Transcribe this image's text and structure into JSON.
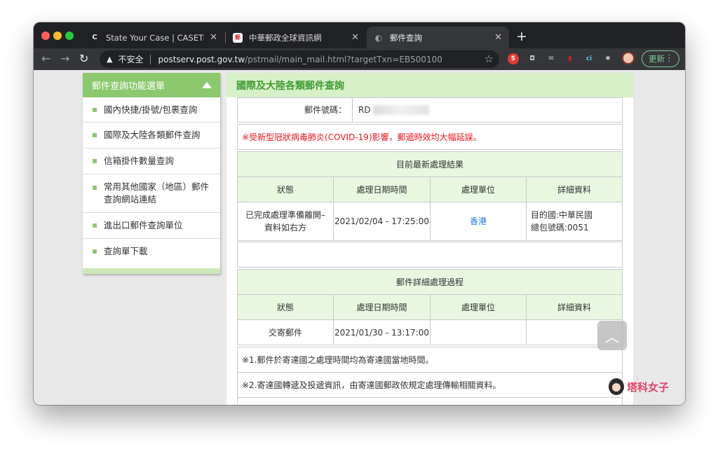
{
  "browser": {
    "tabs": [
      {
        "title": "State Your Case | CASETiFY",
        "favicon": "C",
        "close": "✕"
      },
      {
        "title": "中華郵政全球資訊網",
        "favicon": "郵",
        "close": "✕"
      },
      {
        "title": "郵件查詢",
        "favicon": "◐",
        "close": "✕"
      }
    ],
    "new_tab": "+",
    "nav": {
      "back": "←",
      "forward": "→",
      "reload": "↻"
    },
    "address": {
      "warning_icon": "▲",
      "insecure_label": "不安全",
      "host": "postserv.post.gov.tw",
      "path": "/pstmail/main_mail.html?targetTxn=EB500100",
      "star": "☆"
    },
    "extensions": [
      {
        "name": "s-extension-icon",
        "glyph": "S",
        "color": "#e53935"
      },
      {
        "name": "pocket-icon",
        "glyph": "◘",
        "color": "#bdc1c6"
      },
      {
        "name": "mail-icon",
        "glyph": "✉",
        "color": "#bdc1c6"
      },
      {
        "name": "book-icon",
        "glyph": "▮",
        "color": "#c62828"
      },
      {
        "name": "ci-extension-icon",
        "glyph": "ci",
        "color": "#4fc3f7"
      },
      {
        "name": "puzzle-icon",
        "glyph": "✱",
        "color": "#bdc1c6"
      },
      {
        "name": "cast-icon",
        "glyph": "▭",
        "color": "#bdc1c6"
      },
      {
        "name": "profile-avatar-icon",
        "glyph": "●",
        "color": "#f0c7b1"
      }
    ],
    "update_label": "更新",
    "menu_dots": "⋮"
  },
  "sidebar": {
    "title": "郵件查詢功能選單",
    "items": [
      {
        "label": "國內快捷/掛號/包裹查詢"
      },
      {
        "label": "國際及大陸各類郵件查詢"
      },
      {
        "label": "信箱掛件數量查詢"
      },
      {
        "label": "常用其他國家（地區）郵件查詢網站連結"
      },
      {
        "label": "進出口郵件查詢單位"
      },
      {
        "label": "查詢單下載"
      }
    ]
  },
  "main": {
    "title": "國際及大陸各類郵件查詢",
    "tracking_label": "郵件號碼：",
    "tracking_value": "RD",
    "notice": "※受新型冠狀病毒肺炎(COVID-19)影響，郵遞時效均大幅延誤。",
    "latest_section": "目前最新處理結果",
    "columns": [
      "狀態",
      "處理日期時間",
      "處理單位",
      "詳細資料"
    ],
    "latest_row": {
      "status": "已完成處理準備離開–資料如右方",
      "datetime": "2021/02/04 - 17:25:00",
      "unit": "香港",
      "detail_line1": "目的國:中華民國",
      "detail_line2": "總包號碼:0051"
    },
    "history_section": "郵件詳細處理過程",
    "history_row": {
      "status": "交寄郵件",
      "datetime": "2021/01/30 - 13:17:00",
      "unit": "",
      "detail": ""
    },
    "notes": [
      "※1.郵件於寄達國之處理時間均為寄達國當地時間。",
      "※2.寄達國轉遞及投遞資訊，由寄達國郵政依規定處理傳輸相關資料。"
    ]
  },
  "scroll_top": "︿",
  "watermark": "塔科女子"
}
